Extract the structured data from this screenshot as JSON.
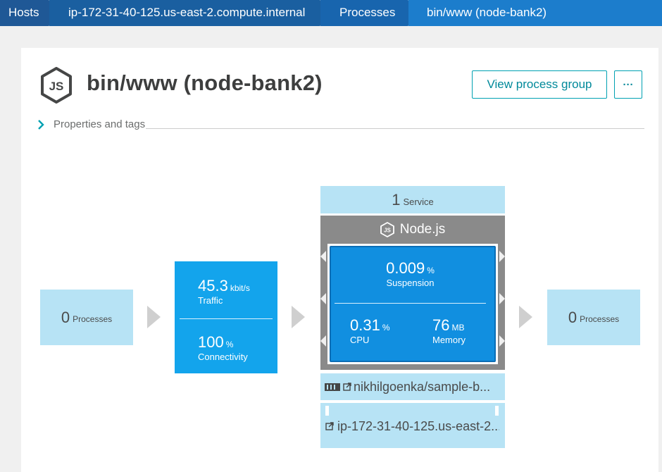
{
  "breadcrumb": {
    "items": [
      "Hosts",
      "ip-172-31-40-125.us-east-2.compute.internal",
      "Processes",
      "bin/www (node-bank2)"
    ]
  },
  "header": {
    "title": "bin/www (node-bank2)",
    "view_button": "View process group",
    "more_button": "···",
    "properties_label": "Properties and tags"
  },
  "flow": {
    "left": {
      "count": "0",
      "unit": "Processes"
    },
    "traffic": {
      "value": "45.3",
      "unit": "kbit/s",
      "label": "Traffic"
    },
    "connectivity": {
      "value": "100",
      "unit": "%",
      "label": "Connectivity"
    },
    "services": {
      "count": "1",
      "unit": "Service"
    },
    "process": {
      "tech": "Node.js",
      "suspension": {
        "value": "0.009",
        "unit": "%",
        "label": "Suspension"
      },
      "cpu": {
        "value": "0.31",
        "unit": "%",
        "label": "CPU"
      },
      "memory": {
        "value": "76",
        "unit": "MB",
        "label": "Memory"
      }
    },
    "container": "nikhilgoenka/sample-b...",
    "host": "ip-172-31-40-125.us-east-2...",
    "right": {
      "count": "0",
      "unit": "Processes"
    }
  },
  "colors": {
    "breadcrumb_bg": "#1a5fa0",
    "accent": "#00a1b2",
    "light_blue": "#b7e3f5",
    "traffic_blue": "#13a4ec",
    "process_blue": "#118fe0",
    "frame_gray": "#8a8a8a"
  },
  "icons": [
    "chevron-right-icon",
    "nodejs-icon",
    "container-icon",
    "external-link-icon"
  ]
}
